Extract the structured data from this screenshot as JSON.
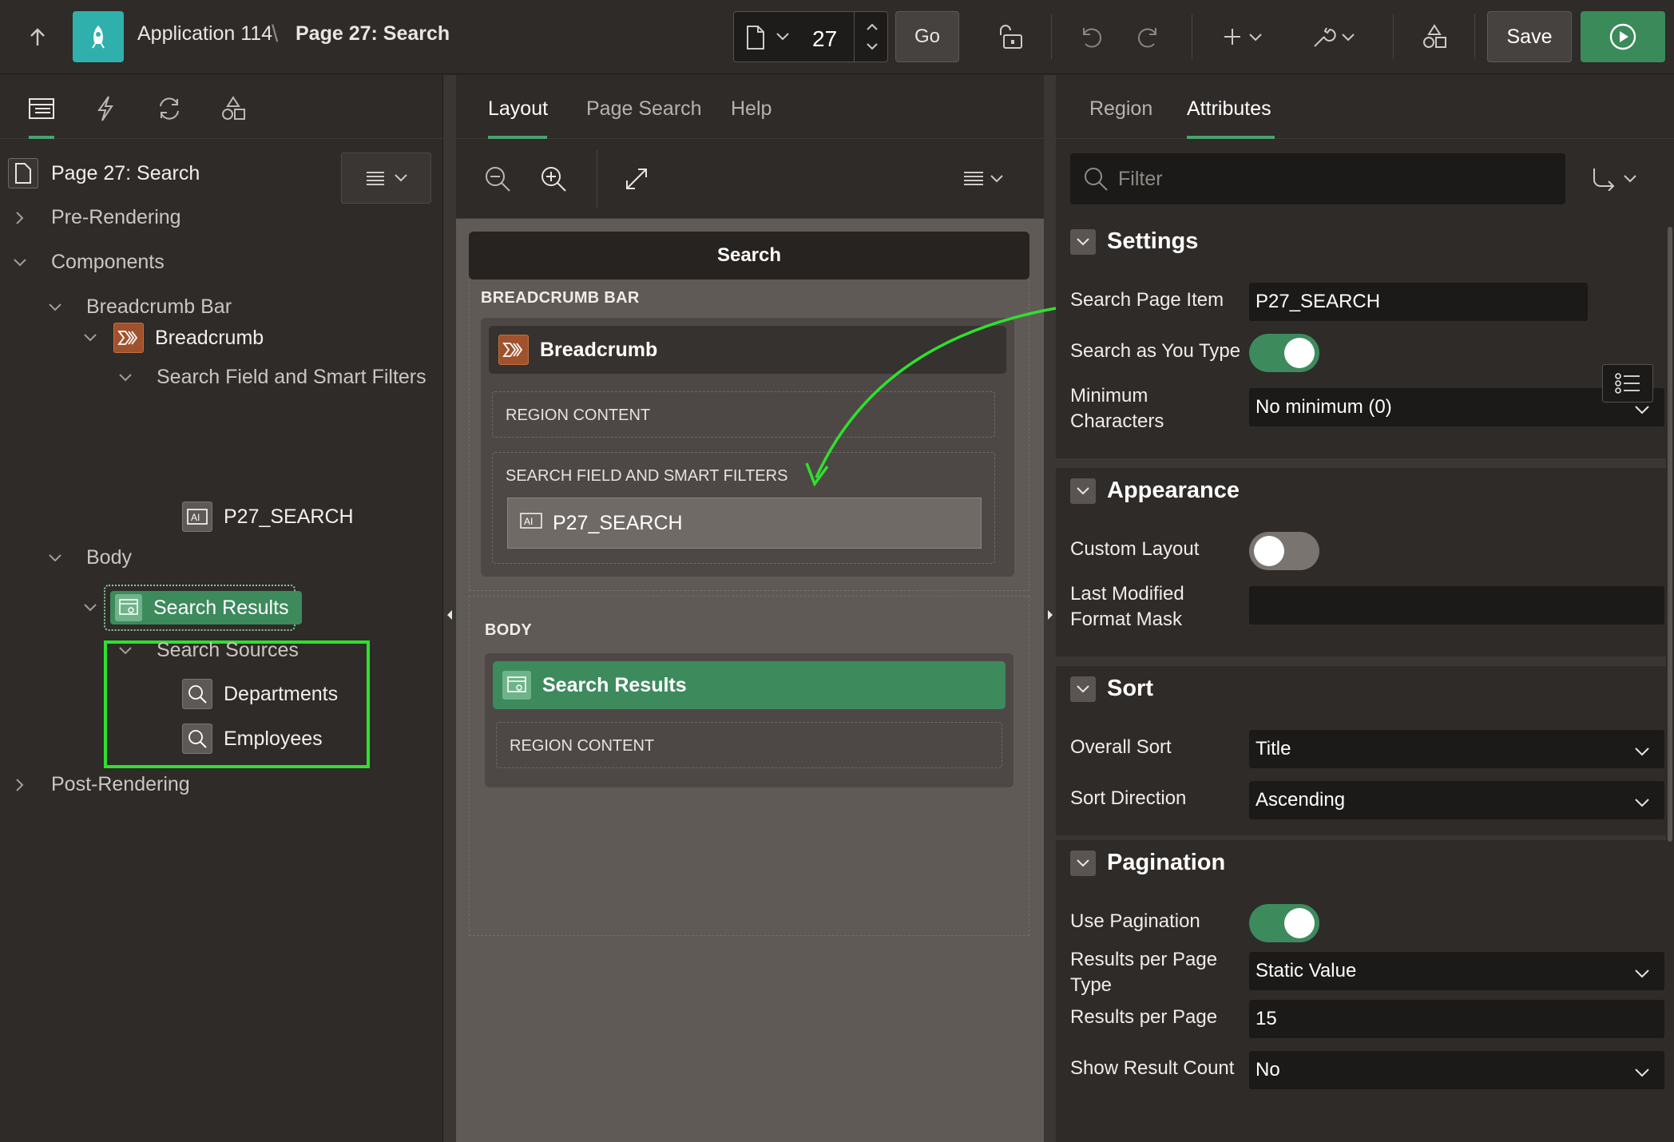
{
  "header": {
    "app_name": "Application 114",
    "separator": "\\",
    "page_name": "Page 27: Search",
    "page_number": "27",
    "go_label": "Go",
    "save_label": "Save"
  },
  "left": {
    "root_label": "Page 27: Search",
    "tree": {
      "pre_rendering": "Pre-Rendering",
      "components": "Components",
      "breadcrumb_bar": "Breadcrumb Bar",
      "breadcrumb": "Breadcrumb",
      "search_field": "Search Field and Smart Filters",
      "p27_search": "P27_SEARCH",
      "body": "Body",
      "search_results": "Search Results",
      "search_sources": "Search Sources",
      "departments": "Departments",
      "employees": "Employees",
      "post_rendering": "Post-Rendering"
    }
  },
  "center": {
    "tabs": [
      "Layout",
      "Page Search",
      "Help"
    ],
    "grid_title": "Search",
    "breadcrumb_bar_label": "BREADCRUMB BAR",
    "breadcrumb_region": "Breadcrumb",
    "region_content": "REGION CONTENT",
    "search_field_slot": "SEARCH FIELD AND SMART FILTERS",
    "p27_item": "P27_SEARCH",
    "body_label": "BODY",
    "search_results_region": "Search Results",
    "body_region_content": "REGION CONTENT"
  },
  "right": {
    "tabs": [
      "Region",
      "Attributes"
    ],
    "filter_placeholder": "Filter",
    "groups": {
      "settings": "Settings",
      "appearance": "Appearance",
      "sort": "Sort",
      "pagination": "Pagination"
    },
    "props": {
      "search_page_item_label": "Search Page Item",
      "search_page_item_value": "P27_SEARCH",
      "search_as_you_type_label": "Search as You Type",
      "min_chars_label_1": "Minimum",
      "min_chars_label_2": "Characters",
      "min_chars_value": "No minimum (0)",
      "custom_layout_label": "Custom Layout",
      "last_modified_label_1": "Last Modified",
      "last_modified_label_2": "Format Mask",
      "last_modified_value": "",
      "overall_sort_label": "Overall Sort",
      "overall_sort_value": "Title",
      "sort_direction_label": "Sort Direction",
      "sort_direction_value": "Ascending",
      "use_pagination_label": "Use Pagination",
      "rpp_type_label_1": "Results per Page",
      "rpp_type_label_2": "Type",
      "rpp_type_value": "Static Value",
      "rpp_label": "Results per Page",
      "rpp_value": "15",
      "show_count_label": "Show Result Count",
      "show_count_value": "No"
    },
    "toggles": {
      "search_as_you_type": true,
      "custom_layout": false,
      "use_pagination": true
    }
  },
  "colors": {
    "accent_green": "#3d8a5d",
    "app_logo": "#2fb0ad",
    "highlight": "#2fe02f",
    "breadcrumb_icon": "#a0522d"
  }
}
